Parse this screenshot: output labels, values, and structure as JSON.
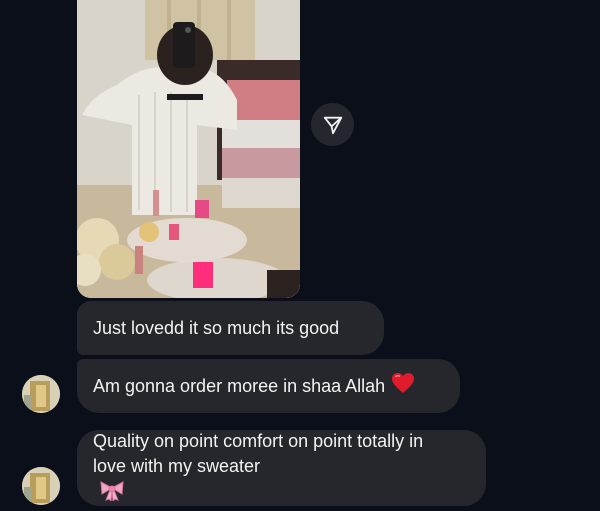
{
  "messages": [
    {
      "text": "Just lovedd it so much its good"
    },
    {
      "text": "Am gonna order moree in shaa Allah",
      "emoji": "heart-icon",
      "emoji_color": "#e01b2b"
    },
    {
      "text_line1": "Quality on point comfort on point totally in",
      "text_line2": "love with my sweater",
      "emoji": "ribbon-bow-icon",
      "emoji_color": "#f3a4c6"
    }
  ],
  "theme": {
    "background": "#0b0f1a",
    "bubble": "#26272d",
    "text": "#f3f3f3",
    "share_button": "#25272e"
  },
  "icons": {
    "share": "send-paper-plane-icon"
  }
}
